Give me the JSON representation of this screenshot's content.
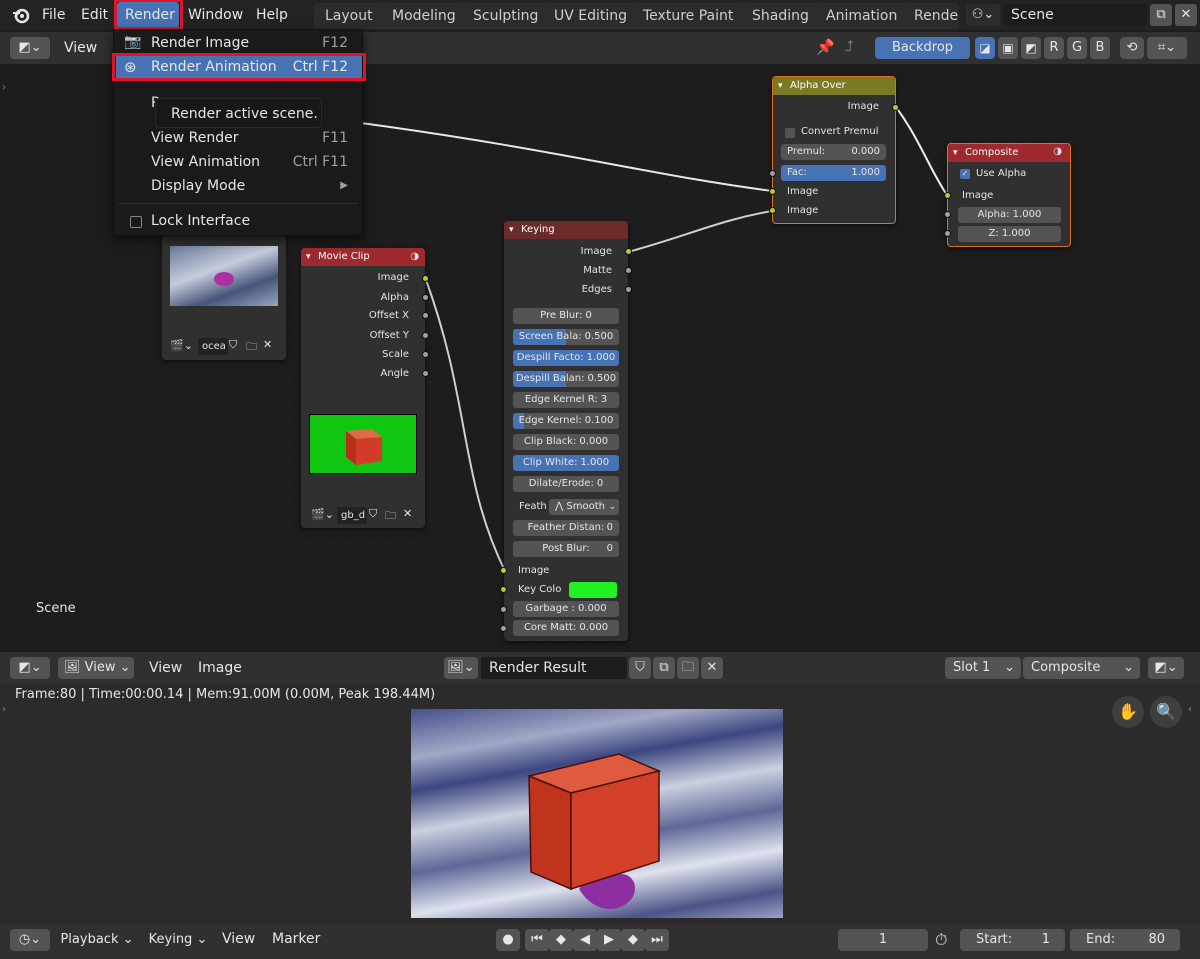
{
  "topbar": {
    "menus": [
      "File",
      "Edit",
      "Render",
      "Window",
      "Help"
    ],
    "workspaces": [
      "Layout",
      "Modeling",
      "Sculpting",
      "UV Editing",
      "Texture Paint",
      "Shading",
      "Animation",
      "Rende"
    ],
    "scene": "Scene"
  },
  "node_header": {
    "view": "View",
    "backdrop": "Backdrop",
    "channels": [
      "R",
      "G",
      "B"
    ]
  },
  "render_menu": {
    "items": [
      {
        "label": "Render Image",
        "shortcut": "F12"
      },
      {
        "label": "Render Animation",
        "shortcut": "Ctrl F12"
      },
      {
        "label": "View Render",
        "shortcut": "F11"
      },
      {
        "label": "View Animation",
        "shortcut": "Ctrl F11"
      },
      {
        "label": "Display Mode",
        "shortcut": ""
      }
    ],
    "lock_interface": "Lock Interface",
    "partial_item": "R"
  },
  "tooltip": "Render active scene.",
  "nodes": {
    "image_node": {
      "name": "ocea"
    },
    "movie_clip": {
      "title": "Movie Clip",
      "outputs": [
        "Image",
        "Alpha",
        "Offset X",
        "Offset Y",
        "Scale",
        "Angle"
      ],
      "clip": "gb_d"
    },
    "keying": {
      "title": "Keying",
      "outputs": [
        "Image",
        "Matte",
        "Edges"
      ],
      "fields": [
        {
          "label": "Pre Blur:",
          "value": "0",
          "blue": false,
          "fill": 0
        },
        {
          "label": "Screen Bala:",
          "value": "0.500",
          "blue": false,
          "fill": 0.5
        },
        {
          "label": "Despill Facto:",
          "value": "1.000",
          "blue": true,
          "fill": 1
        },
        {
          "label": "Despill Balan:",
          "value": "0.500",
          "blue": false,
          "fill": 0.5
        },
        {
          "label": "Edge Kernel R:",
          "value": "3",
          "blue": false,
          "fill": 0
        },
        {
          "label": "Edge Kernel:",
          "value": "0.100",
          "blue": false,
          "fill": 0.1
        },
        {
          "label": "Clip Black:",
          "value": "0.000",
          "blue": false,
          "fill": 0
        },
        {
          "label": "Clip White:",
          "value": "1.000",
          "blue": true,
          "fill": 1
        },
        {
          "label": "Dilate/Erode:",
          "value": "0",
          "blue": false,
          "fill": 0
        }
      ],
      "feather_label": "Feath",
      "feather_value": "Smooth",
      "fields2": [
        {
          "label": "Feather Distan:",
          "value": "0"
        },
        {
          "label": "Post Blur:",
          "value": "0"
        }
      ],
      "inputs": [
        "Image",
        "Key Colo"
      ],
      "fields3": [
        {
          "label": "Garbage :",
          "value": "0.000"
        },
        {
          "label": "Core Matt:",
          "value": "0.000"
        }
      ],
      "key_color": "#22f022"
    },
    "alpha_over": {
      "title": "Alpha Over",
      "output": "Image",
      "convert": "Convert Premul",
      "premul_label": "Premul:",
      "premul_value": "0.000",
      "fac_label": "Fac:",
      "fac_value": "1.000",
      "inputs": [
        "Image",
        "Image"
      ]
    },
    "composite": {
      "title": "Composite",
      "use_alpha": "Use Alpha",
      "input": "Image",
      "alpha_label": "Alpha:",
      "alpha_value": "1.000",
      "z_label": "Z:",
      "z_value": "1.000"
    }
  },
  "scene_label": "Scene",
  "image_editor": {
    "view1": "View",
    "view2": "View",
    "image": "Image",
    "result": "Render Result",
    "slot": "Slot 1",
    "composite": "Composite",
    "info": "Frame:80 | Time:00:00.14 | Mem:91.00M (0.00M, Peak 198.44M)"
  },
  "timeline": {
    "menus": [
      "Playback",
      "Keying",
      "View",
      "Marker"
    ],
    "current_frame": "1",
    "start_label": "Start:",
    "start": "1",
    "end_label": "End:",
    "end": "80"
  },
  "colors": {
    "accent": "#4772b3",
    "highlight_red": "#e0142a",
    "node_header_red": "#9e2a2f",
    "node_header_yellow": "#7a7a25",
    "keying_header": "#6b2b2b"
  }
}
